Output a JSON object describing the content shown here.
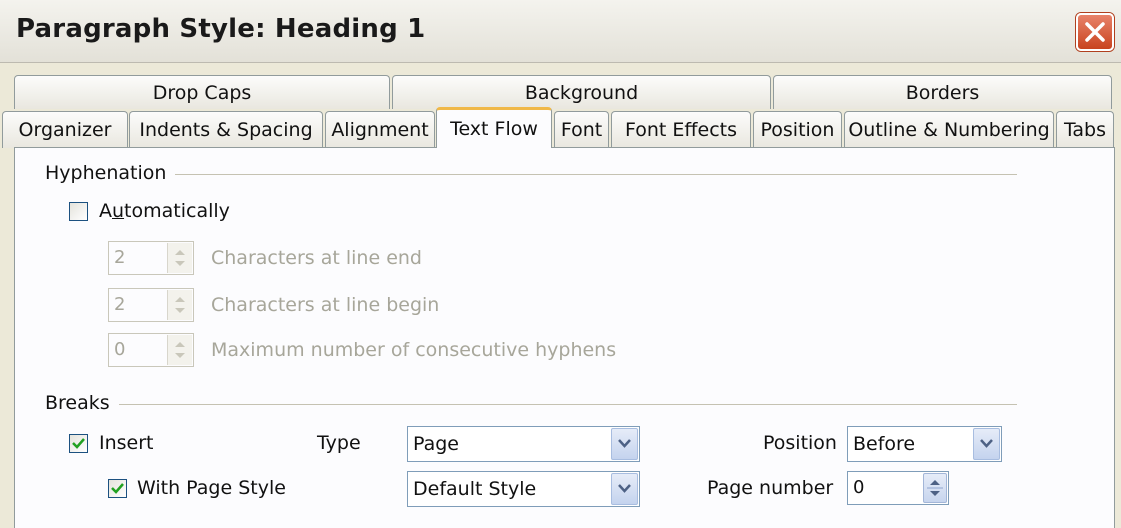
{
  "window": {
    "title": "Paragraph Style: Heading 1"
  },
  "tabs": {
    "row1": [
      "Drop Caps",
      "Background",
      "Borders"
    ],
    "row2": [
      "Organizer",
      "Indents & Spacing",
      "Alignment",
      "Text Flow",
      "Font",
      "Font Effects",
      "Position",
      "Outline & Numbering",
      "Tabs"
    ],
    "active": "Text Flow"
  },
  "hyphenation": {
    "label": "Hyphenation",
    "automatically_label": "Automatically",
    "automatically_checked": false,
    "chars_line_end": {
      "value": "2",
      "label": "Characters at line end"
    },
    "chars_line_begin": {
      "value": "2",
      "label": "Characters at line begin"
    },
    "max_hyphens": {
      "value": "0",
      "label": "Maximum number of consecutive hyphens"
    }
  },
  "breaks": {
    "label": "Breaks",
    "insert_label": "Insert",
    "insert_checked": true,
    "type_label": "Type",
    "type_value": "Page",
    "position_label": "Position",
    "position_value": "Before",
    "with_page_style_label": "With Page Style",
    "with_page_style_checked": true,
    "page_style_value": "Default Style",
    "page_number_label": "Page number",
    "page_number_value": "0"
  },
  "colors": {
    "accent_tab": "#f0b848",
    "close_button": "#c8431f",
    "check": "#21a121"
  }
}
